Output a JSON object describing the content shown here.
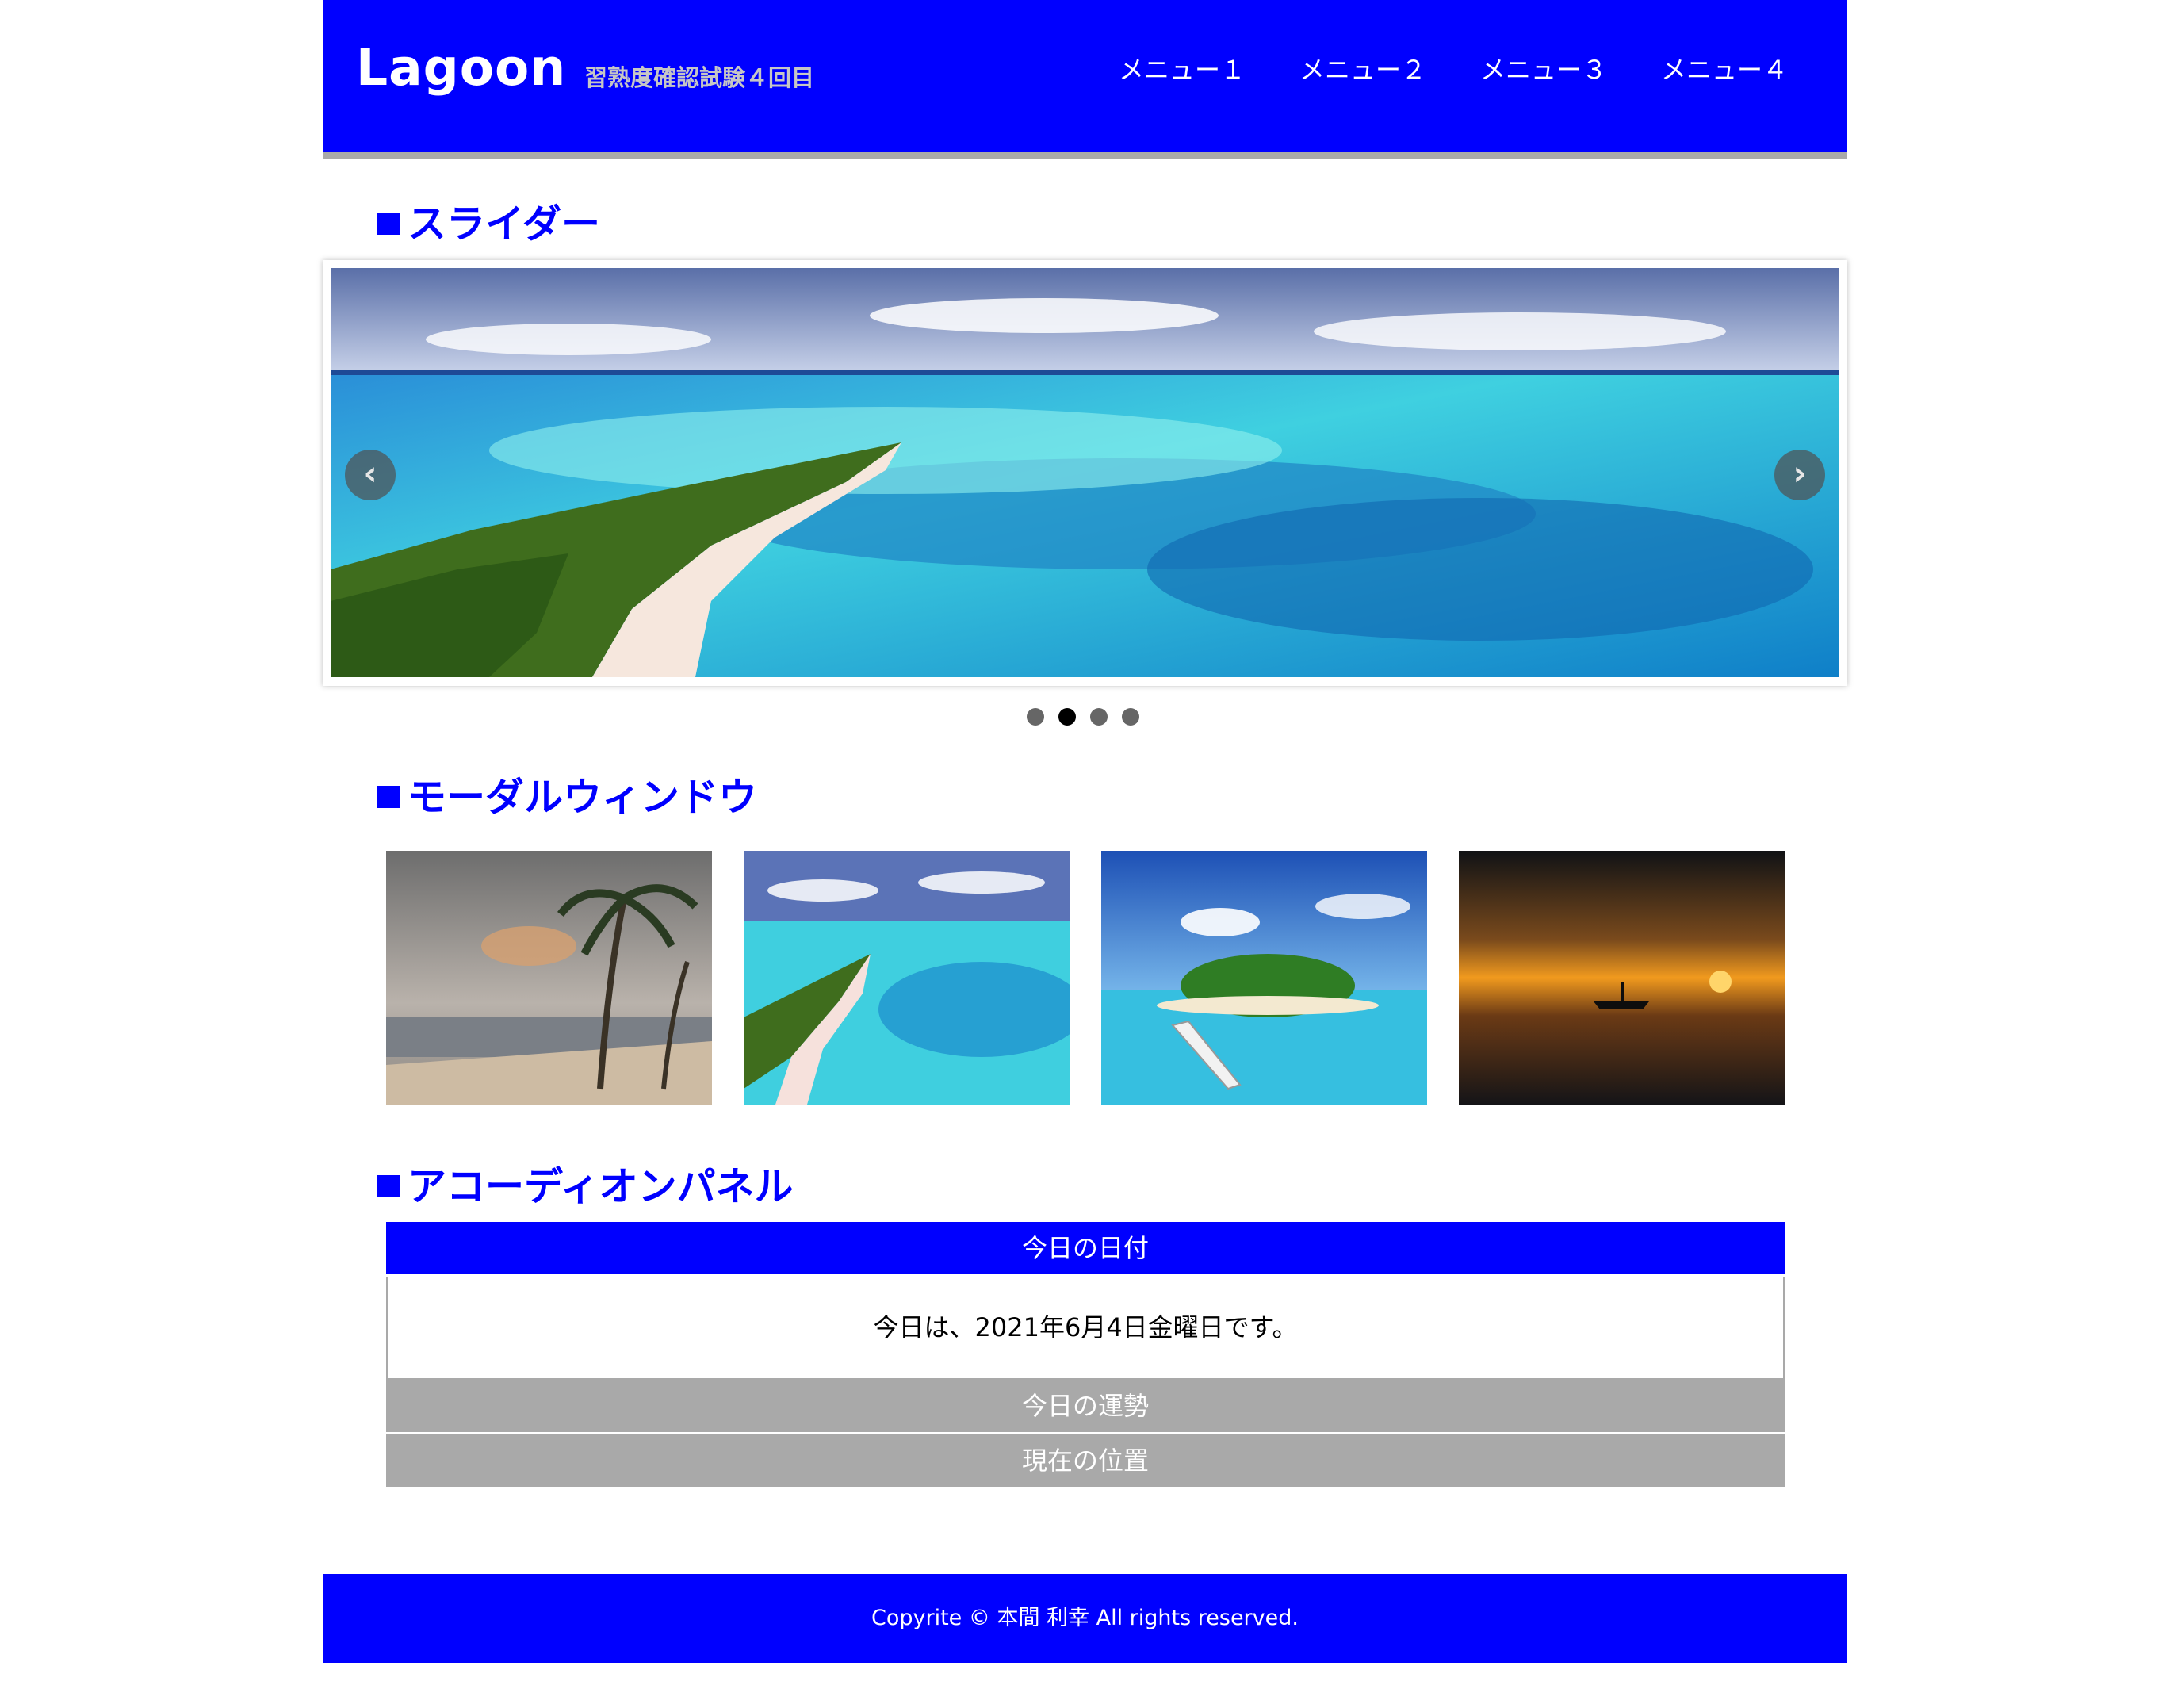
{
  "header": {
    "logo": "Lagoon",
    "subtitle": "習熟度確認試験４回目",
    "nav": [
      "メニュー１",
      "メニュー２",
      "メニュー３",
      "メニュー４"
    ]
  },
  "sections": {
    "slider_title": "スライダー",
    "modal_title": "モーダルウィンドウ",
    "accordion_title": "アコーディオンパネル"
  },
  "slider": {
    "active_index": 1,
    "slide_count": 4,
    "prev_icon": "chevron-left-icon",
    "next_icon": "chevron-right-icon"
  },
  "accordion": {
    "items": [
      {
        "title": "今日の日付",
        "body": "今日は、2021年6月4日金曜日です。",
        "open": true
      },
      {
        "title": "今日の運勢",
        "open": false
      },
      {
        "title": "現在の位置",
        "open": false
      }
    ]
  },
  "footer": {
    "text": "Copyrite © 本間 利幸 All rights reserved."
  },
  "colors": {
    "brand": "#0000ff",
    "inactive": "#a9a9a9",
    "subtitle": "#c6c6c6"
  }
}
